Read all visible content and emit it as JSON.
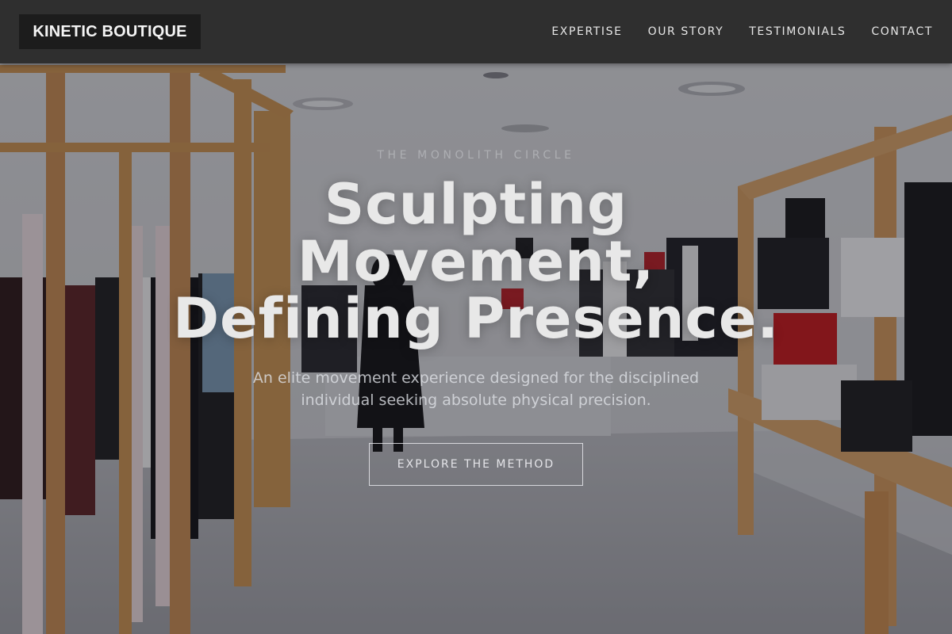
{
  "header": {
    "brand": "KINETIC BOUTIQUE",
    "nav": [
      {
        "label": "EXPERTISE"
      },
      {
        "label": "OUR STORY"
      },
      {
        "label": "TESTIMONIALS"
      },
      {
        "label": "CONTACT"
      }
    ]
  },
  "hero": {
    "eyebrow": "THE MONOLITH CIRCLE",
    "headline_lines": [
      "Sculpting",
      "Movement,",
      "Defining Presence."
    ],
    "subhead": "An elite movement experience designed for the disciplined individual seeking absolute physical precision.",
    "cta_label": "EXPLORE THE METHOD",
    "background": "clothing-boutique-interior-photo"
  },
  "colors": {
    "header_bg": "#2f2f2f",
    "brand_bg": "#1c1c1c",
    "text_light": "#e8e8e8"
  }
}
